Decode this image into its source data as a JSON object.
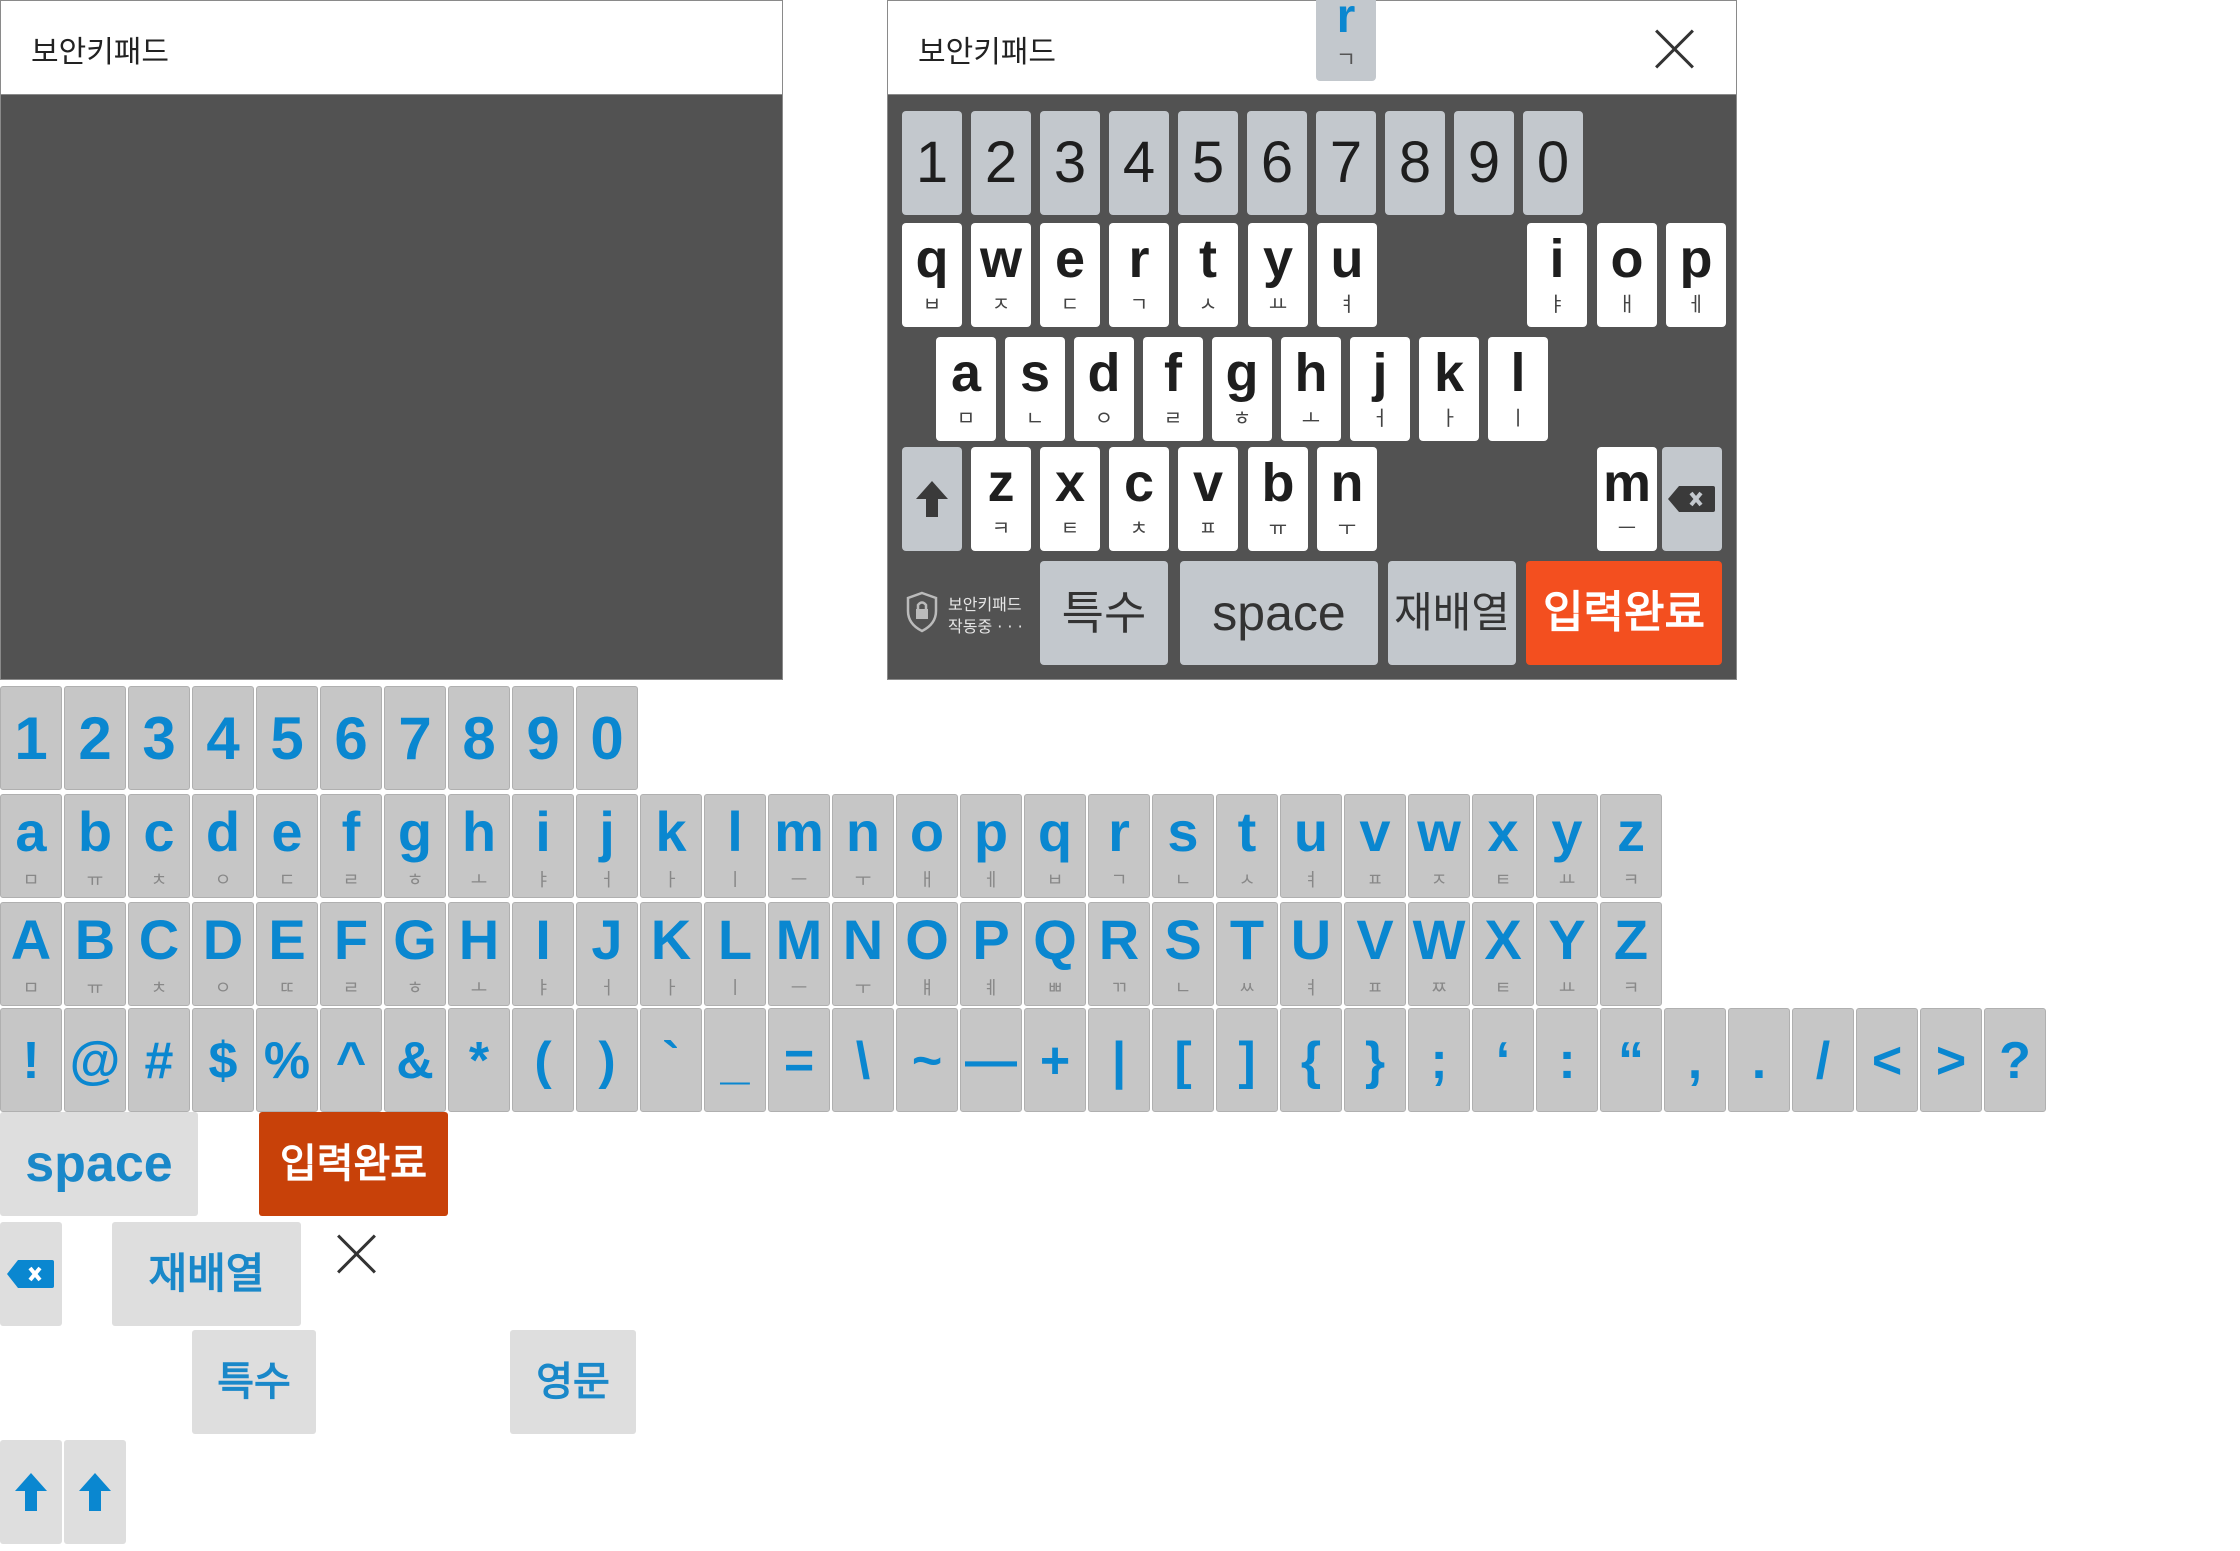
{
  "left_panel": {
    "title": "보안키패드"
  },
  "right_panel": {
    "title": "보안키패드",
    "numbers": [
      "1",
      "2",
      "3",
      "4",
      "5",
      "6",
      "7",
      "8",
      "9",
      "0"
    ],
    "popup": {
      "main": "r",
      "sub": "ㄱ"
    },
    "row_q": [
      [
        "q",
        "ㅂ"
      ],
      [
        "w",
        "ㅈ"
      ],
      [
        "e",
        "ㄷ"
      ],
      [
        "r",
        "ㄱ"
      ],
      [
        "t",
        "ㅅ"
      ],
      [
        "y",
        "ㅛ"
      ],
      [
        "u",
        "ㅕ"
      ],
      [
        "i",
        "ㅑ"
      ],
      [
        "o",
        "ㅐ"
      ],
      [
        "p",
        "ㅔ"
      ]
    ],
    "row_a": [
      [
        "a",
        "ㅁ"
      ],
      [
        "s",
        "ㄴ"
      ],
      [
        "d",
        "ㅇ"
      ],
      [
        "f",
        "ㄹ"
      ],
      [
        "g",
        "ㅎ"
      ],
      [
        "h",
        "ㅗ"
      ],
      [
        "j",
        "ㅓ"
      ],
      [
        "k",
        "ㅏ"
      ],
      [
        "l",
        "ㅣ"
      ]
    ],
    "row_z": [
      [
        "z",
        "ㅋ"
      ],
      [
        "x",
        "ㅌ"
      ],
      [
        "c",
        "ㅊ"
      ],
      [
        "v",
        "ㅍ"
      ],
      [
        "b",
        "ㅠ"
      ],
      [
        "n",
        "ㅜ"
      ],
      [
        "m",
        "ㅡ"
      ]
    ],
    "badge": {
      "line1": "보안키패드",
      "line2": "작동중 · · ·"
    },
    "special_label": "특수",
    "space_label": "space",
    "rearrange_label": "재배열",
    "done_label": "입력완료"
  },
  "sprite": {
    "numbers": [
      "1",
      "2",
      "3",
      "4",
      "5",
      "6",
      "7",
      "8",
      "9",
      "0"
    ],
    "lower": [
      [
        "a",
        "ㅁ"
      ],
      [
        "b",
        "ㅠ"
      ],
      [
        "c",
        "ㅊ"
      ],
      [
        "d",
        "ㅇ"
      ],
      [
        "e",
        "ㄷ"
      ],
      [
        "f",
        "ㄹ"
      ],
      [
        "g",
        "ㅎ"
      ],
      [
        "h",
        "ㅗ"
      ],
      [
        "i",
        "ㅑ"
      ],
      [
        "j",
        "ㅓ"
      ],
      [
        "k",
        "ㅏ"
      ],
      [
        "l",
        "ㅣ"
      ],
      [
        "m",
        "ㅡ"
      ],
      [
        "n",
        "ㅜ"
      ],
      [
        "o",
        "ㅐ"
      ],
      [
        "p",
        "ㅔ"
      ],
      [
        "q",
        "ㅂ"
      ],
      [
        "r",
        "ㄱ"
      ],
      [
        "s",
        "ㄴ"
      ],
      [
        "t",
        "ㅅ"
      ],
      [
        "u",
        "ㅕ"
      ],
      [
        "v",
        "ㅍ"
      ],
      [
        "w",
        "ㅈ"
      ],
      [
        "x",
        "ㅌ"
      ],
      [
        "y",
        "ㅛ"
      ],
      [
        "z",
        "ㅋ"
      ]
    ],
    "upper": [
      [
        "A",
        "ㅁ"
      ],
      [
        "B",
        "ㅠ"
      ],
      [
        "C",
        "ㅊ"
      ],
      [
        "D",
        "ㅇ"
      ],
      [
        "E",
        "ㄸ"
      ],
      [
        "F",
        "ㄹ"
      ],
      [
        "G",
        "ㅎ"
      ],
      [
        "H",
        "ㅗ"
      ],
      [
        "I",
        "ㅑ"
      ],
      [
        "J",
        "ㅓ"
      ],
      [
        "K",
        "ㅏ"
      ],
      [
        "L",
        "ㅣ"
      ],
      [
        "M",
        "ㅡ"
      ],
      [
        "N",
        "ㅜ"
      ],
      [
        "O",
        "ㅒ"
      ],
      [
        "P",
        "ㅖ"
      ],
      [
        "Q",
        "ㅃ"
      ],
      [
        "R",
        "ㄲ"
      ],
      [
        "S",
        "ㄴ"
      ],
      [
        "T",
        "ㅆ"
      ],
      [
        "U",
        "ㅕ"
      ],
      [
        "V",
        "ㅍ"
      ],
      [
        "W",
        "ㅉ"
      ],
      [
        "X",
        "ㅌ"
      ],
      [
        "Y",
        "ㅛ"
      ],
      [
        "Z",
        "ㅋ"
      ]
    ],
    "symbols": [
      "!",
      "@",
      "#",
      "$",
      "%",
      "^",
      "&",
      "*",
      "(",
      ")",
      "`",
      "_",
      "=",
      "\\",
      "~",
      "—",
      "+",
      "|",
      "[",
      "]",
      "{",
      "}",
      ";",
      "‘",
      ":",
      "“",
      ",",
      ".",
      "/",
      "<",
      ">",
      "?"
    ],
    "space_label": "space",
    "done_label": "입력완료",
    "rearrange_label": "재배열",
    "special_label": "특수",
    "english_label": "영문"
  },
  "colors": {
    "accent_blue": "#0a87d0",
    "done_orange": "#f34f1f",
    "done_dark": "#c84109",
    "panel_gray": "#525252"
  }
}
